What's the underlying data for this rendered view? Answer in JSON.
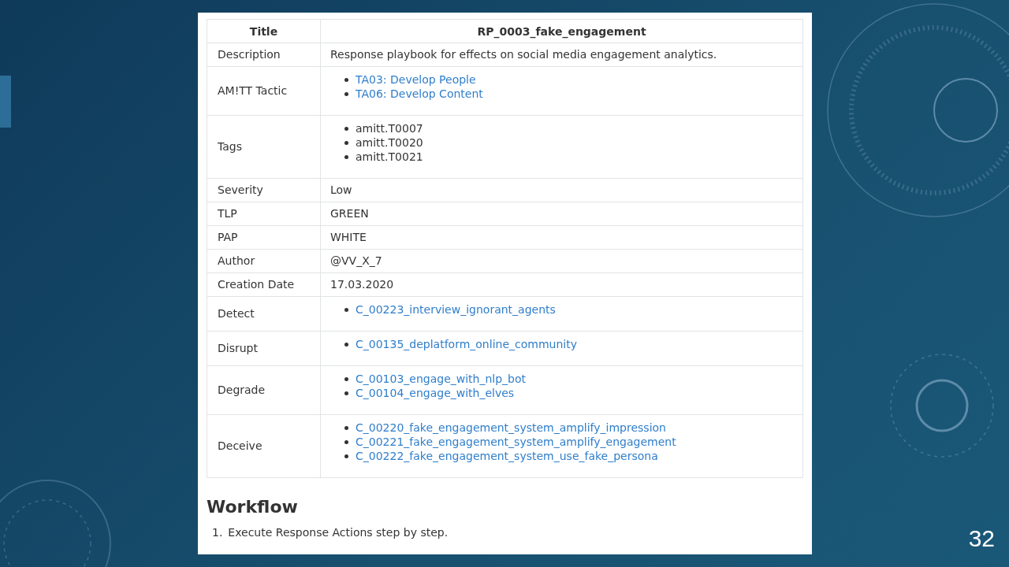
{
  "document": {
    "table": {
      "header": [
        "Title",
        "RP_0003_fake_engagement"
      ],
      "rows": [
        {
          "label": "Description",
          "kind": "text",
          "value": "Response playbook for effects on social media engagement analytics."
        },
        {
          "label": "AM!TT Tactic",
          "kind": "list",
          "items": [
            {
              "text": "TA03: Develop People",
              "link": true
            },
            {
              "text": "TA06: Develop Content",
              "link": true
            }
          ]
        },
        {
          "label": "Tags",
          "kind": "list",
          "items": [
            {
              "text": "amitt.T0007",
              "link": false
            },
            {
              "text": "amitt.T0020",
              "link": false
            },
            {
              "text": "amitt.T0021",
              "link": false
            }
          ]
        },
        {
          "label": "Severity",
          "kind": "text",
          "value": "Low"
        },
        {
          "label": "TLP",
          "kind": "text",
          "value": "GREEN"
        },
        {
          "label": "PAP",
          "kind": "text",
          "value": "WHITE"
        },
        {
          "label": "Author",
          "kind": "text",
          "value": "@VV_X_7"
        },
        {
          "label": "Creation Date",
          "kind": "text",
          "value": "17.03.2020"
        },
        {
          "label": "Detect",
          "kind": "list",
          "items": [
            {
              "text": "C_00223_interview_ignorant_agents",
              "link": true
            }
          ]
        },
        {
          "label": "Disrupt",
          "kind": "list",
          "items": [
            {
              "text": "C_00135_deplatform_online_community",
              "link": true
            }
          ]
        },
        {
          "label": "Degrade",
          "kind": "list",
          "items": [
            {
              "text": "C_00103_engage_with_nlp_bot",
              "link": true
            },
            {
              "text": "C_00104_engage_with_elves",
              "link": true
            }
          ]
        },
        {
          "label": "Deceive",
          "kind": "list",
          "items": [
            {
              "text": "C_00220_fake_engagement_system_amplify_impression",
              "link": true
            },
            {
              "text": "C_00221_fake_engagement_system_amplify_engagement",
              "link": true
            },
            {
              "text": "C_00222_fake_engagement_system_use_fake_persona",
              "link": true
            }
          ]
        }
      ]
    },
    "heading": "Workflow",
    "steps": [
      {
        "number": "1.",
        "text": "Execute Response Actions step by step."
      }
    ]
  },
  "slide": {
    "page_number": "32"
  }
}
